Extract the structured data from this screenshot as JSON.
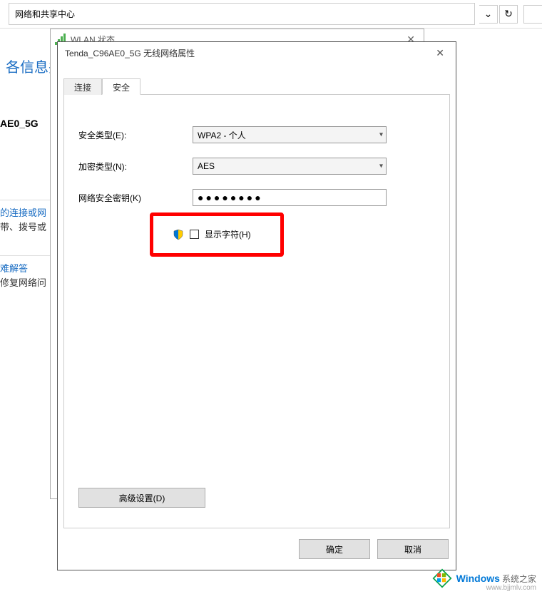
{
  "topbar": {
    "breadcrumb": "网络和共享中心",
    "refresh_glyph": "↻",
    "dropdown_glyph": "⌄"
  },
  "side": {
    "title_fragment": "各信息并",
    "ssid": "AE0_5G",
    "conn_line1": "的连接或网",
    "conn_line2": "带、拨号或",
    "troubleshoot": "难解答",
    "repair": "修复网络问"
  },
  "wlan_status": {
    "title": "WLAN 状态",
    "close_glyph": "✕"
  },
  "prop": {
    "title": "Tenda_C96AE0_5G 无线网络属性",
    "close_glyph": "✕",
    "tabs": {
      "connection": "连接",
      "security": "安全"
    },
    "labels": {
      "security_type": "安全类型(E):",
      "encryption_type": "加密类型(N):",
      "network_key": "网络安全密钥(K)"
    },
    "values": {
      "security_type": "WPA2 - 个人",
      "encryption_type": "AES",
      "network_key_masked": "●●●●●●●●"
    },
    "show_chars_label": "显示字符(H)",
    "advanced_button": "高级设置(D)",
    "ok_button": "确定",
    "cancel_button": "取消"
  },
  "watermark": {
    "brand": "Windows",
    "sub": "系统之家",
    "url": "www.bjjmlv.com"
  }
}
